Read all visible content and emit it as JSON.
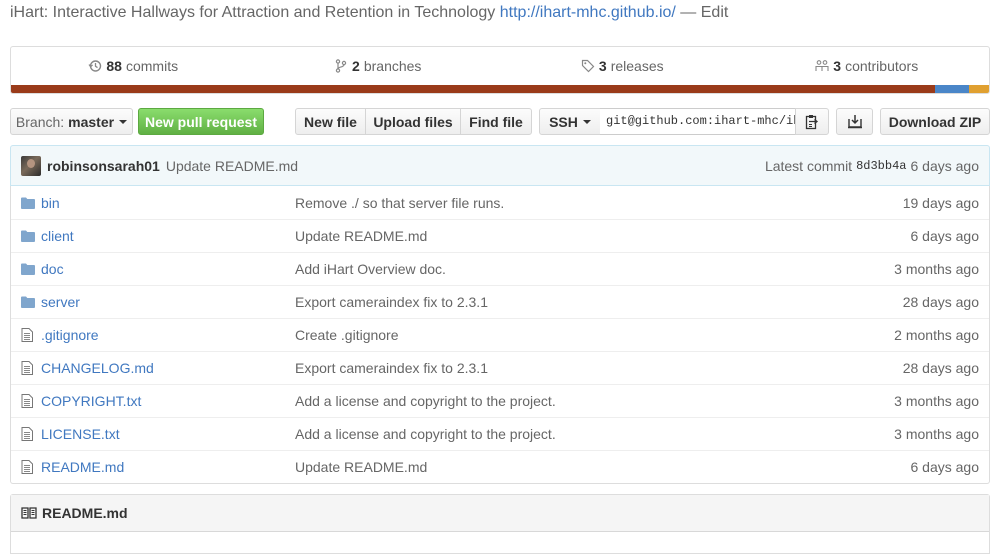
{
  "repo": {
    "description": "iHart: Interactive Hallways for Attraction and Retention in Technology",
    "homepage": "http://ihart-mhc.github.io/",
    "edit_label": "— Edit"
  },
  "stats": {
    "commits_count": "88",
    "commits_label": "commits",
    "branches_count": "2",
    "branches_label": "branches",
    "releases_count": "3",
    "releases_label": "releases",
    "contributors_count": "3",
    "contributors_label": "contributors"
  },
  "language_colors": [
    "#9a3b1a",
    "#4a86c8",
    "#e0a030"
  ],
  "toolbar": {
    "branch_prefix": "Branch:",
    "branch_name": "master",
    "new_pull_request": "New pull request",
    "new_file": "New file",
    "upload_files": "Upload files",
    "find_file": "Find file",
    "clone_protocol": "SSH",
    "clone_url": "git@github.com:ihart-mhc/ihart.git",
    "download_zip": "Download ZIP"
  },
  "latest_commit": {
    "author": "robinsonsarah01",
    "message": "Update README.md",
    "label": "Latest commit",
    "sha": "8d3bb4a",
    "age": "6 days ago"
  },
  "files": [
    {
      "type": "folder",
      "name": "bin",
      "message": "Remove ./ so that server file runs.",
      "age": "19 days ago"
    },
    {
      "type": "folder",
      "name": "client",
      "message": "Update README.md",
      "age": "6 days ago"
    },
    {
      "type": "folder",
      "name": "doc",
      "message": "Add iHart Overview doc.",
      "age": "3 months ago"
    },
    {
      "type": "folder",
      "name": "server",
      "message": "Export cameraindex fix to 2.3.1",
      "age": "28 days ago"
    },
    {
      "type": "file",
      "name": ".gitignore",
      "message": "Create .gitignore",
      "age": "2 months ago"
    },
    {
      "type": "file",
      "name": "CHANGELOG.md",
      "message": "Export cameraindex fix to 2.3.1",
      "age": "28 days ago"
    },
    {
      "type": "file",
      "name": "COPYRIGHT.txt",
      "message": "Add a license and copyright to the project.",
      "age": "3 months ago"
    },
    {
      "type": "file",
      "name": "LICENSE.txt",
      "message": "Add a license and copyright to the project.",
      "age": "3 months ago"
    },
    {
      "type": "file",
      "name": "README.md",
      "message": "Update README.md",
      "age": "6 days ago"
    }
  ],
  "readme": {
    "title": "README.md"
  }
}
